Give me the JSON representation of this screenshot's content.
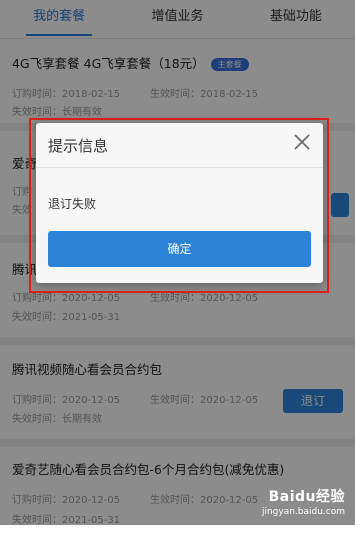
{
  "tabs": [
    {
      "label": "我的套餐",
      "active": true
    },
    {
      "label": "增值业务",
      "active": false
    },
    {
      "label": "基础功能",
      "active": false
    }
  ],
  "packages": [
    {
      "title": "4G飞享套餐 4G飞享套餐（18元）",
      "badge": "主套餐",
      "order_time": "订购时间：2018-02-15",
      "effective_time": "生效时间：2018-02-15",
      "expire_time": "失效时间：长期有效"
    },
    {
      "title": "爱奇",
      "order_time": "订购",
      "effective_time": "",
      "expire_time": "失效"
    },
    {
      "title": "腾讯",
      "order_time": "订购时间：2020-12-05",
      "effective_time": "生效时间：2020-12-05",
      "expire_time": "失效时间：2021-05-31"
    },
    {
      "title": "腾讯视频随心看会员合约包",
      "order_time": "订购时间：2020-12-05",
      "effective_time": "生效时间：2020-12-05",
      "expire_time": "失效时间：长期有效",
      "action": "退订"
    },
    {
      "title": "爱奇艺随心看会员合约包-6个月合约包(减免优惠)",
      "order_time": "订购时间：2020-12-05",
      "effective_time": "生效时间：2020-12-05",
      "expire_time": "失效时间：2021-05-31"
    }
  ],
  "dialog": {
    "title": "提示信息",
    "message": "退订失败",
    "confirm_label": "确定"
  },
  "watermark": {
    "logo": "Baidu经验",
    "url": "jingyan.baidu.com"
  },
  "colors": {
    "accent": "#2d7ad6",
    "button": "#2b82d7",
    "highlight": "#e02020"
  }
}
